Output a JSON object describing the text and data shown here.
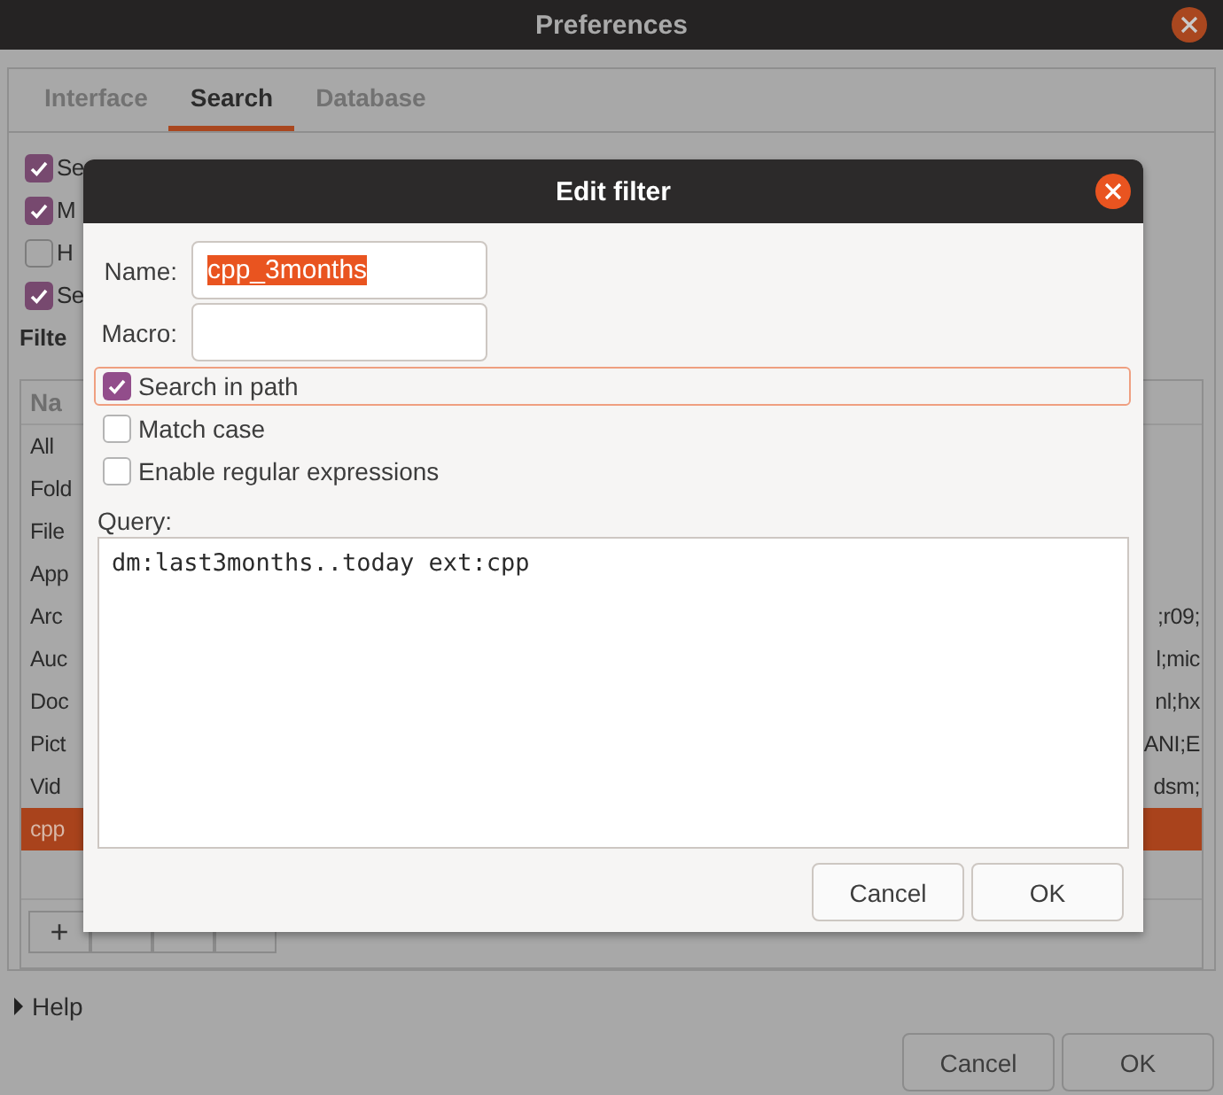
{
  "window": {
    "title": "Preferences"
  },
  "tabs": [
    {
      "label": "Interface",
      "selected": false
    },
    {
      "label": "Search",
      "selected": true
    },
    {
      "label": "Database",
      "selected": false
    }
  ],
  "options": [
    {
      "label": "Se",
      "checked": true
    },
    {
      "label": "M",
      "checked": true
    },
    {
      "label": "H",
      "checked": false
    },
    {
      "label": "Se",
      "checked": true
    }
  ],
  "filters": {
    "label": "Filte",
    "column": "Na",
    "rows": [
      {
        "name": "All",
        "end": "",
        "selected": false
      },
      {
        "name": "Fold",
        "end": "",
        "selected": false
      },
      {
        "name": "File",
        "end": "",
        "selected": false
      },
      {
        "name": "App",
        "end": "",
        "selected": false
      },
      {
        "name": "Arc",
        "end": ";r09;",
        "selected": false
      },
      {
        "name": "Auc",
        "end": "l;mic",
        "selected": false
      },
      {
        "name": "Doc",
        "end": "nl;hx",
        "selected": false
      },
      {
        "name": "Pict",
        "end": "ANI;E",
        "selected": false
      },
      {
        "name": "Vid",
        "end": "dsm;",
        "selected": false
      },
      {
        "name": "cpp",
        "end": "",
        "selected": true
      }
    ],
    "toolbar": [
      "+"
    ]
  },
  "help": {
    "label": "Help",
    "expanded": false
  },
  "buttons": [
    "Cancel",
    "OK"
  ],
  "dialog": {
    "title": "Edit filter",
    "name": {
      "label": "Name:",
      "value": "cpp_3months",
      "text_selected": true
    },
    "macro": {
      "label": "Macro:"
    },
    "options": [
      {
        "label": "Search in path",
        "checked": true,
        "focused": true
      },
      {
        "label": "Match case",
        "checked": false,
        "focused": false
      },
      {
        "label": "Enable regular expressions",
        "checked": false,
        "focused": false
      }
    ],
    "query": {
      "label": "Query:",
      "value": "dm:last3months..today ext:cpp"
    },
    "buttons": [
      "Cancel",
      "OK"
    ]
  }
}
